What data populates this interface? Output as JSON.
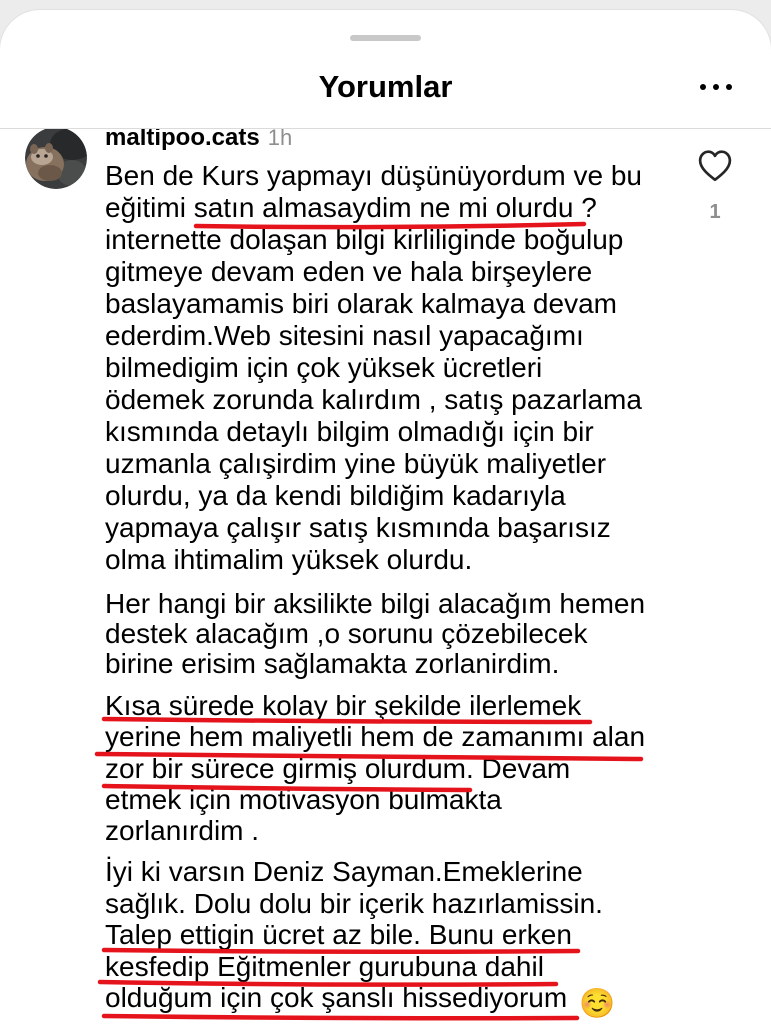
{
  "sheet": {
    "title": "Yorumlar"
  },
  "icons": {
    "drag_handle": "drag-handle",
    "more": "more-horizontal-icon",
    "like": "heart-outline-icon",
    "emoji": "smiling-face-emoji"
  },
  "comment": {
    "username": "maltipoo.cats",
    "time": "1h",
    "like_count": "1",
    "paragraphs": [
      {
        "lines": [
          "Ben de Kurs yapmayı düşünüyordum ve bu",
          "eğitimi satın almasaydim ne mi olurdu ?",
          "internette dolaşan bilgi kirliliginde boğulup",
          "gitmeye devam eden ve hala birşeylere",
          "baslayamamis biri olarak kalmaya devam",
          "ederdim.Web sitesini nasıl yapacağımı",
          "bilmedigim için çok yüksek ücretleri",
          "ödemek zorunda kalırdım , satış pazarlama",
          "kısmında detaylı bilgim olmadığı için bir",
          "uzmanla çalışirdim yine büyük maliyetler",
          "olurdu, ya da kendi bildiğim kadarıyla",
          "yapmaya çalışır satış kısmında başarısız",
          "olma ihtimalim yüksek olurdu."
        ]
      },
      {
        "lines": [
          "Her hangi bir aksilikte bilgi alacağım hemen",
          "destek alacağım ,o sorunu çözebilecek",
          "birine erisim sağlamakta zorlanirdim."
        ]
      },
      {
        "lines": [
          "Kısa sürede kolay bir şekilde ilerlemek",
          "yerine hem maliyetli hem de zamanımı alan",
          "zor bir sürece girmiş olurdum. Devam",
          "etmek için motivasyon bulmakta",
          "zorlanırdim ."
        ]
      },
      {
        "lines": [
          "İyi ki varsın Deniz Sayman.Emeklerine",
          "sağlık. Dolu dolu bir içerik hazırlamissin.",
          "Talep ettigin ücret az bile. Bunu erken",
          "kesfedip Eğitmenler gurubuna dahil",
          "olduğum için çok şanslı hissediyorum"
        ],
        "emoji": "☺️"
      }
    ]
  },
  "colors": {
    "text": "#000000",
    "meta_text": "#8e8e8e",
    "divider": "#dbdbdb",
    "drag_handle": "#c8c8c8",
    "annotation_red": "#e5141c",
    "emoji_yellow": "#ffcc4d"
  }
}
